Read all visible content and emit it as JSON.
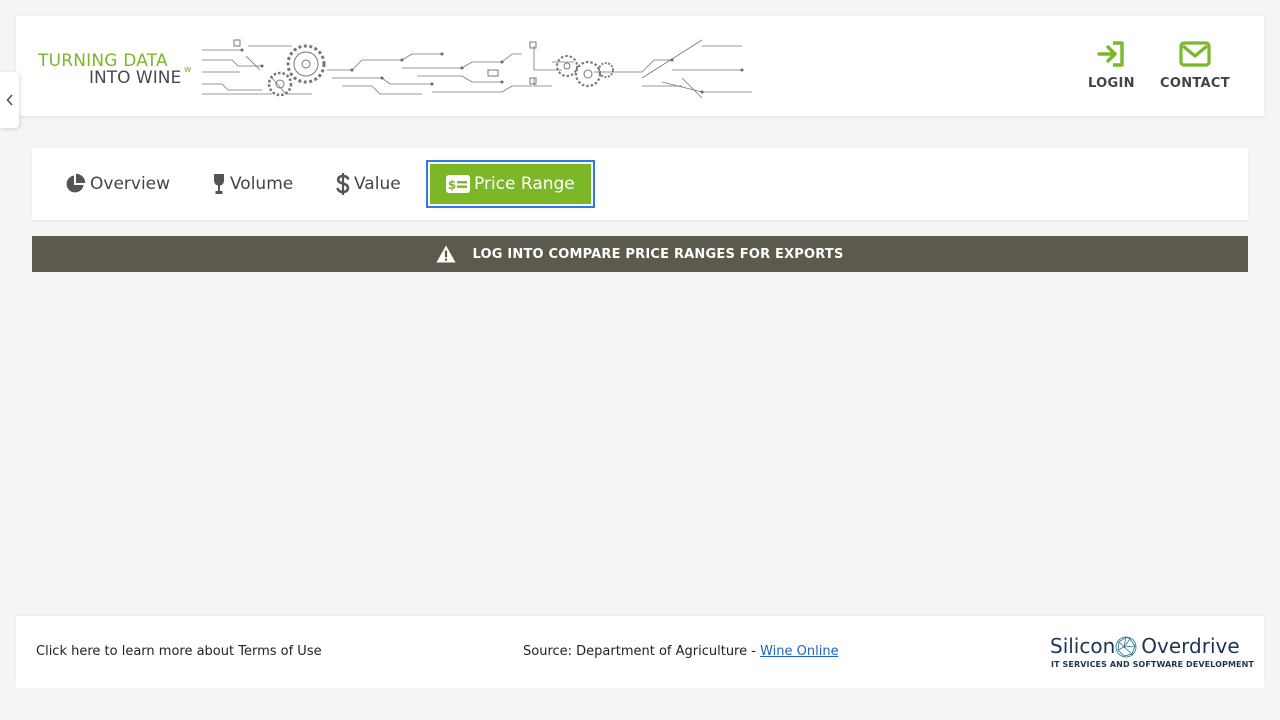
{
  "logo": {
    "line1": "TURNING DATA",
    "line2": "INTO WINE",
    "mark": "w"
  },
  "header": {
    "actions": [
      {
        "label": "LOGIN",
        "icon": "sign-in-icon"
      },
      {
        "label": "CONTACT",
        "icon": "envelope-icon"
      }
    ]
  },
  "tabs": [
    {
      "label": "Overview",
      "icon": "pie-chart-icon",
      "active": false
    },
    {
      "label": "Volume",
      "icon": "wine-glass-icon",
      "active": false
    },
    {
      "label": "Value",
      "icon": "dollar-icon",
      "active": false
    },
    {
      "label": "Price Range",
      "icon": "money-bill-icon",
      "active": true
    }
  ],
  "banner": {
    "icon": "warning-icon",
    "text": "LOG INTO COMPARE PRICE RANGES FOR EXPORTS"
  },
  "footer": {
    "terms": "Click here to learn more about Terms of Use",
    "source_prefix": "Source: Department of Agriculture - ",
    "source_link": "Wine Online",
    "brand_name_1": "Silicon",
    "brand_name_2": "Overdrive",
    "brand_tagline": "IT SERVICES AND SOFTWARE DEVELOPMENT"
  },
  "colors": {
    "accent": "#7cb728",
    "banner_bg": "#5c5a4d",
    "focus_outline": "#2d7be6",
    "link": "#1a66c9",
    "brand": "#1d3555"
  }
}
